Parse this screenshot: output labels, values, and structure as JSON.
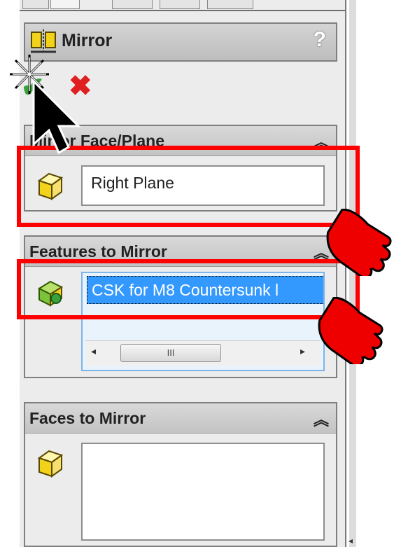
{
  "header": {
    "title": "Mirror",
    "help_label": "?"
  },
  "actions": {
    "ok_icon": "checkmark-icon",
    "cancel_icon": "x-icon"
  },
  "scrollbar": {
    "left": "◂",
    "right": "▸",
    "grip": "III",
    "edge_arrow": "◂"
  },
  "groups": [
    {
      "title": "Mirror Face/Plane",
      "collapse": "≈",
      "value": "Right Plane"
    },
    {
      "title": "Features to Mirror",
      "collapse": "≈",
      "items": [
        "CSK for M8 Countersunk l"
      ]
    },
    {
      "title": "Faces to Mirror",
      "collapse": "≈",
      "value": ""
    }
  ],
  "colors": {
    "highlight": "#ff0000",
    "selection": "#3399ff",
    "panel": "#ececec"
  }
}
